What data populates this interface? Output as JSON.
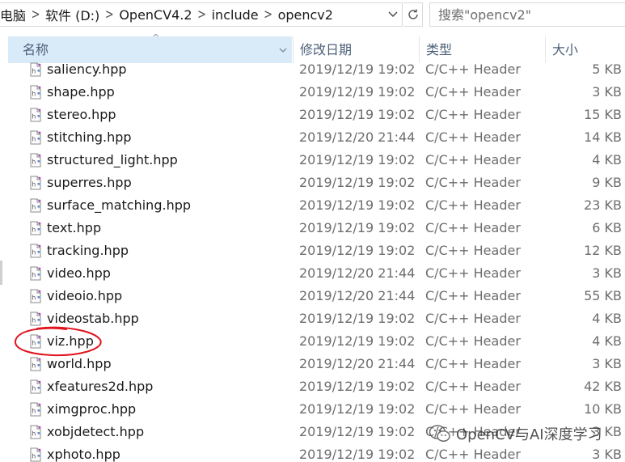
{
  "address": {
    "crumbs": [
      "电脑",
      "软件 (D:)",
      "OpenCV4.2",
      "include",
      "opencv2"
    ],
    "search_placeholder": "搜索\"opencv2\""
  },
  "columns": {
    "name": "名称",
    "date": "修改日期",
    "type": "类型",
    "size": "大小"
  },
  "files": [
    {
      "name": "saliency.hpp",
      "date": "2019/12/19 19:02",
      "type": "C/C++ Header",
      "size": "5 KB"
    },
    {
      "name": "shape.hpp",
      "date": "2019/12/19 19:02",
      "type": "C/C++ Header",
      "size": "3 KB"
    },
    {
      "name": "stereo.hpp",
      "date": "2019/12/19 19:02",
      "type": "C/C++ Header",
      "size": "15 KB"
    },
    {
      "name": "stitching.hpp",
      "date": "2019/12/20 21:44",
      "type": "C/C++ Header",
      "size": "14 KB"
    },
    {
      "name": "structured_light.hpp",
      "date": "2019/12/19 19:02",
      "type": "C/C++ Header",
      "size": "4 KB"
    },
    {
      "name": "superres.hpp",
      "date": "2019/12/19 19:02",
      "type": "C/C++ Header",
      "size": "9 KB"
    },
    {
      "name": "surface_matching.hpp",
      "date": "2019/12/19 19:02",
      "type": "C/C++ Header",
      "size": "23 KB"
    },
    {
      "name": "text.hpp",
      "date": "2019/12/19 19:02",
      "type": "C/C++ Header",
      "size": "6 KB"
    },
    {
      "name": "tracking.hpp",
      "date": "2019/12/19 19:02",
      "type": "C/C++ Header",
      "size": "12 KB"
    },
    {
      "name": "video.hpp",
      "date": "2019/12/20 21:44",
      "type": "C/C++ Header",
      "size": "3 KB"
    },
    {
      "name": "videoio.hpp",
      "date": "2019/12/20 21:44",
      "type": "C/C++ Header",
      "size": "55 KB"
    },
    {
      "name": "videostab.hpp",
      "date": "2019/12/19 19:02",
      "type": "C/C++ Header",
      "size": "4 KB"
    },
    {
      "name": "viz.hpp",
      "date": "2019/12/19 19:02",
      "type": "C/C++ Header",
      "size": "4 KB"
    },
    {
      "name": "world.hpp",
      "date": "2019/12/20 21:44",
      "type": "C/C++ Header",
      "size": "3 KB"
    },
    {
      "name": "xfeatures2d.hpp",
      "date": "2019/12/19 19:02",
      "type": "C/C++ Header",
      "size": "42 KB"
    },
    {
      "name": "ximgproc.hpp",
      "date": "2019/12/19 19:02",
      "type": "C/C++ Header",
      "size": "10 KB"
    },
    {
      "name": "xobjdetect.hpp",
      "date": "2019/12/19 19:02",
      "type": "C/C++ Header",
      "size": "3 KB"
    },
    {
      "name": "xphoto.hpp",
      "date": "2019/12/19 19:02",
      "type": "C/C++ Header",
      "size": "3 KB"
    }
  ],
  "watermark": "OpenCV与AI深度学习",
  "colors": {
    "header_selected": "#d9ebf9",
    "annotation": "#e0141e"
  }
}
